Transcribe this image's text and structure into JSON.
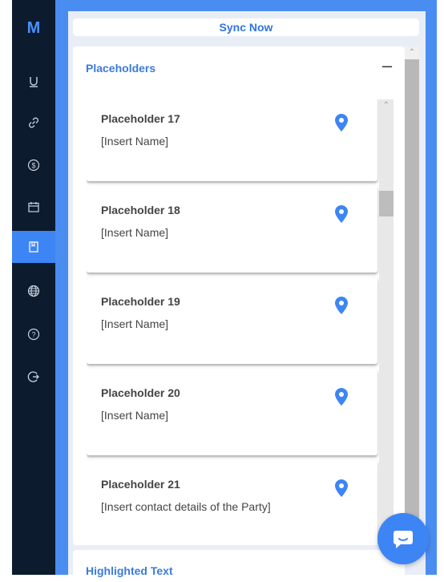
{
  "sidebar": {
    "logo": "M",
    "items": [
      {
        "icon": "underline-icon",
        "active": false
      },
      {
        "icon": "link-icon",
        "active": false
      },
      {
        "icon": "dollar-icon",
        "active": false
      },
      {
        "icon": "calendar-icon",
        "active": false
      },
      {
        "icon": "bookmark-icon",
        "active": true
      },
      {
        "icon": "globe-icon",
        "active": false
      },
      {
        "icon": "help-icon",
        "active": false
      },
      {
        "icon": "logout-icon",
        "active": false
      }
    ],
    "active_color": "#3d85f5"
  },
  "toolbar": {
    "sync_label": "Sync Now"
  },
  "placeholders": {
    "title": "Placeholders",
    "collapse_symbol": "–",
    "items": [
      {
        "title": "Placeholder 17",
        "value": "[Insert Name]"
      },
      {
        "title": "Placeholder 18",
        "value": "[Insert Name]"
      },
      {
        "title": "Placeholder 19",
        "value": "[Insert Name]"
      },
      {
        "title": "Placeholder 20",
        "value": "[Insert Name]"
      },
      {
        "title": "Placeholder 21",
        "value": "[Insert contact details of the Party]"
      }
    ]
  },
  "next_section": {
    "title": "Highlighted Text"
  },
  "colors": {
    "accent": "#4a8df0",
    "pin": "#3d85f5",
    "sidebar_bg": "#0d1b2e"
  }
}
